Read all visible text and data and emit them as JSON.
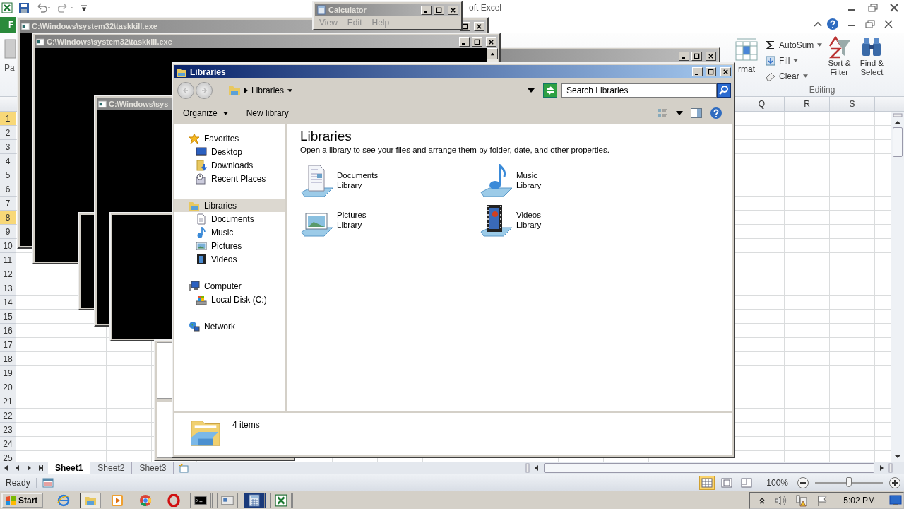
{
  "excel": {
    "title": "oft Excel",
    "file_tab": "F",
    "paste": "Pa",
    "format": "rmat",
    "editing": {
      "autosum": "AutoSum",
      "fill": "Fill",
      "clear": "Clear",
      "sort": "Sort & Filter",
      "find": "Find & Select",
      "group": "Editing"
    },
    "columns": [
      "Q",
      "R",
      "S"
    ],
    "rows": [
      {
        "label": "1",
        "selected": true
      },
      {
        "label": "2",
        "selected": false
      },
      {
        "label": "3",
        "selected": false
      },
      {
        "label": "4",
        "selected": false
      },
      {
        "label": "5",
        "selected": false
      },
      {
        "label": "6",
        "selected": false
      },
      {
        "label": "7",
        "selected": false
      },
      {
        "label": "8",
        "selected": true
      },
      {
        "label": "9",
        "selected": false
      },
      {
        "label": "10",
        "selected": false
      },
      {
        "label": "11",
        "selected": false
      },
      {
        "label": "12",
        "selected": false
      },
      {
        "label": "13",
        "selected": false
      },
      {
        "label": "14",
        "selected": false
      },
      {
        "label": "15",
        "selected": false
      },
      {
        "label": "16",
        "selected": false
      },
      {
        "label": "17",
        "selected": false
      },
      {
        "label": "18",
        "selected": false
      },
      {
        "label": "19",
        "selected": false
      },
      {
        "label": "20",
        "selected": false
      },
      {
        "label": "21",
        "selected": false
      },
      {
        "label": "22",
        "selected": false
      },
      {
        "label": "23",
        "selected": false
      },
      {
        "label": "24",
        "selected": false
      },
      {
        "label": "25",
        "selected": false
      }
    ],
    "sheets": [
      {
        "label": "Sheet1",
        "selected": true
      },
      {
        "label": "Sheet2",
        "selected": false
      },
      {
        "label": "Sheet3",
        "selected": false
      }
    ],
    "status": "Ready",
    "views": [
      {
        "selected": true
      },
      {
        "selected": false
      },
      {
        "selected": false
      }
    ],
    "zoom": "100%",
    "zoom_slider": {
      "level": 0.5
    }
  },
  "consoles": [
    {
      "title": "C:\\Windows\\system32\\taskkill.exe"
    },
    {
      "title": "C:\\Windows\\system32\\taskkill.exe"
    },
    {
      "title": "C:\\Windows\\sys"
    }
  ],
  "calculator": {
    "title": "Calculator",
    "menu": [
      "View",
      "Edit",
      "Help"
    ]
  },
  "explorer": {
    "title": "Libraries",
    "breadcrumb": "Libraries",
    "search": {
      "placeholder": "Search Libraries"
    },
    "commands": {
      "organize": "Organize",
      "new_library": "New library"
    },
    "nav": [
      {
        "label": "Favorites",
        "selected": false,
        "children": [
          {
            "label": "Desktop",
            "selected": false
          },
          {
            "label": "Downloads",
            "selected": false
          },
          {
            "label": "Recent Places",
            "selected": false
          }
        ]
      },
      {
        "label": "Libraries",
        "selected": true,
        "children": [
          {
            "label": "Documents",
            "selected": false
          },
          {
            "label": "Music",
            "selected": false
          },
          {
            "label": "Pictures",
            "selected": false
          },
          {
            "label": "Videos",
            "selected": false
          }
        ]
      },
      {
        "label": "Computer",
        "selected": false,
        "children": [
          {
            "label": "Local Disk (C:)",
            "selected": false
          }
        ]
      },
      {
        "label": "Network",
        "selected": false
      }
    ],
    "heading": "Libraries",
    "description": "Open a library to see your files and arrange them by folder, date, and other properties.",
    "libraries": [
      {
        "name": "Documents",
        "type": "Library"
      },
      {
        "name": "Music",
        "type": "Library"
      },
      {
        "name": "Pictures",
        "type": "Library"
      },
      {
        "name": "Videos",
        "type": "Library"
      }
    ],
    "details": "4 items"
  },
  "taskbar": {
    "start": "Start",
    "time": "5:02 PM"
  }
}
